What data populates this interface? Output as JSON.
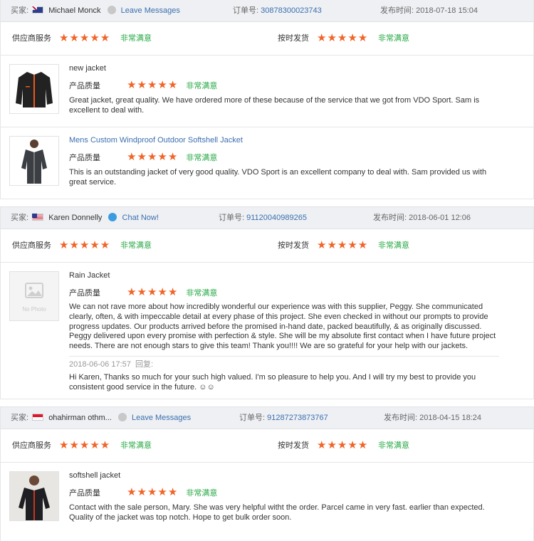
{
  "labels": {
    "buyer": "买家:",
    "order": "订单号:",
    "published": "发布时间:",
    "supplier_service": "供应商服务",
    "on_time_delivery": "按时发货",
    "product_quality": "产品质量",
    "very_satisfied": "非常满意",
    "stars": "★★★★★",
    "reply": "回复:"
  },
  "reviews": [
    {
      "buyer": "Michael Monck",
      "action": "Leave Messages",
      "order_no": "30878300023743",
      "date": "2018-07-18 15:04",
      "products": [
        {
          "title": "new jacket",
          "text": "Great jacket, great quality. We have ordered more of these because of the service that we got from VDO Sport. Sam is excellent to deal with."
        },
        {
          "title": "Mens Custom Windproof Outdoor Softshell Jacket",
          "text": "This is an outstanding jacket of very good quality. VDO Sport is an excellent company to deal with. Sam provided us with great service."
        }
      ]
    },
    {
      "buyer": "Karen Donnelly",
      "action": "Chat Now!",
      "order_no": "91120040989265",
      "date": "2018-06-01 12:06",
      "products": [
        {
          "title": "Rain Jacket",
          "no_photo": "No Photo",
          "text": "We can not rave more about how incredibly wonderful our experience was with this supplier, Peggy. She communicated clearly, often, & with impeccable detail at every phase of this project. She even checked in without our prompts to provide progress updates. Our products arrived before the promised in-hand date, packed beautifully, & as originally discussed. Peggy delivered upon every promise with perfection & style. She will be my absolute first contact when I have future project needs. There are not enough stars to give this team! Thank you!!!! We are so grateful for your help with our jackets.",
          "reply_date": "2018-06-06 17:57",
          "reply_text": "Hi Karen, Thanks so much for your such high valued. I'm so pleasure to help you. And I will try my best to provide you consistent good service in the future. ☺☺"
        }
      ]
    },
    {
      "buyer": "ohahirman othm...",
      "action": "Leave Messages",
      "order_no": "91287273873767",
      "date": "2018-04-15 18:24",
      "products": [
        {
          "title": "softshell jacket",
          "text": "Contact with the sale person, Mary. She was very helpful witht the order. Parcel came in very fast. earlier than expected. Quality of the jacket was top notch. Hope to get bulk order soon."
        }
      ]
    }
  ]
}
